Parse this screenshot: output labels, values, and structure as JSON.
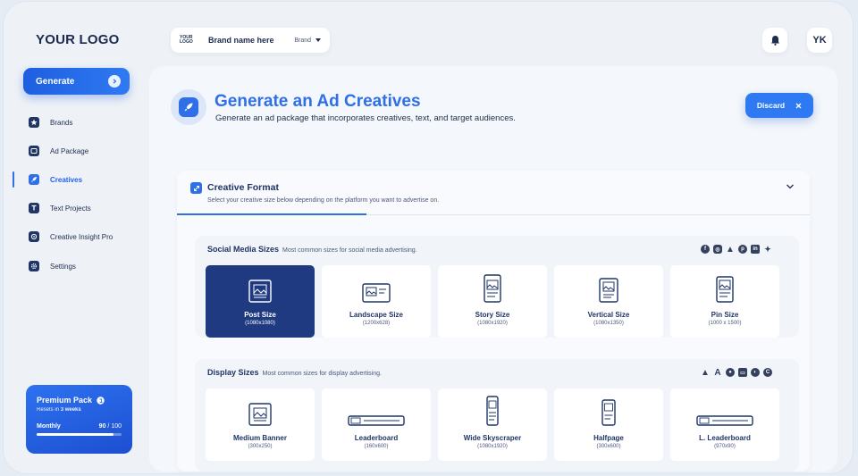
{
  "logo": "YOUR LOGO",
  "brand_selector": {
    "mini_logo": "YOUR LOGO",
    "brand_name": "Brand name here",
    "label": "Brand"
  },
  "user_initials": "YK",
  "sidebar": {
    "generate_label": "Generate",
    "items": [
      {
        "label": "Brands",
        "icon": "star-icon"
      },
      {
        "label": "Ad Package",
        "icon": "package-icon"
      },
      {
        "label": "Creatives",
        "icon": "rocket-icon",
        "active": true
      },
      {
        "label": "Text Projects",
        "icon": "text-icon"
      },
      {
        "label": "Creative Insight Pro",
        "icon": "insight-icon"
      },
      {
        "label": "Settings",
        "icon": "gear-icon"
      }
    ],
    "premium": {
      "title": "Premium Pack",
      "resets_prefix": "Resets in ",
      "resets_value": "3 weeks",
      "period": "Monthly",
      "used": "90",
      "total": "100",
      "progress_fraction": 0.9
    }
  },
  "header": {
    "title": "Generate an Ad Creatives",
    "subtitle": "Generate an ad package that incorporates creatives, text, and target audiences.",
    "discard_label": "Discard"
  },
  "creative_format": {
    "title": "Creative Format",
    "subtitle": "Select your creative size below depending on the platform you want to advertise on."
  },
  "social": {
    "title": "Social Media Sizes",
    "subtitle": "Most common sizes for social media advertising.",
    "platform_icons": [
      "facebook-icon",
      "instagram-icon",
      "google-ads-icon",
      "pinterest-icon",
      "linkedin-icon",
      "twitter-icon"
    ],
    "tiles": [
      {
        "label": "Post Size",
        "size": "(1080x1080)",
        "selected": true
      },
      {
        "label": "Landscape Size",
        "size": "(1200x628)"
      },
      {
        "label": "Story Size",
        "size": "(1080x1920)"
      },
      {
        "label": "Vertical Size",
        "size": "(1080x1350)"
      },
      {
        "label": "Pin Size",
        "size": "(1000 x 1500)"
      }
    ]
  },
  "display": {
    "title": "Display Sizes",
    "subtitle": "Most common sizes for display advertising.",
    "platform_icons": [
      "google-ads-icon",
      "adroll-icon",
      "display-icon",
      "media-icon",
      "network-icon",
      "criteo-icon"
    ],
    "tiles": [
      {
        "label": "Medium Banner",
        "size": "(300x250)"
      },
      {
        "label": "Leaderboard",
        "size": "(160x600)"
      },
      {
        "label": "Wide Skyscraper",
        "size": "(1080x1920)"
      },
      {
        "label": "Halfpage",
        "size": "(300x600)"
      },
      {
        "label": "L. Leaderboard",
        "size": "(970x90)"
      }
    ]
  }
}
